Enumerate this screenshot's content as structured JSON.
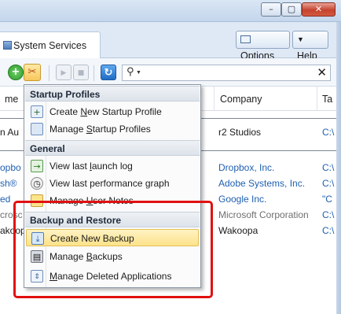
{
  "window": {
    "controls": {
      "minimize": "–",
      "maximize": "▢",
      "close": "✕"
    }
  },
  "tab": {
    "label": "System Services"
  },
  "header": {
    "options": {
      "pre": "",
      "accel": "O",
      "post": "ptions"
    },
    "help": {
      "pre": "",
      "accel": "H",
      "post": "elp"
    }
  },
  "toolbar": {
    "add": "+",
    "tools": "✂",
    "play": "▶",
    "stop": "■",
    "refresh": "↻",
    "search_icon": "⚲",
    "search_dropdown": "▼",
    "search_value": "",
    "clear": "✕"
  },
  "columns": {
    "name": "me",
    "company": "Company",
    "path": "Ta"
  },
  "rows": [
    {
      "name": "n Au",
      "company": "r2 Studios",
      "path": "C:\\",
      "style": "black"
    },
    {
      "name": "opbo",
      "company": "Dropbox, Inc.",
      "path": "C:\\",
      "style": "blue"
    },
    {
      "name": "sh®",
      "company": "Adobe Systems, Inc.",
      "path": "C:\\",
      "style": "blue"
    },
    {
      "name": "ed",
      "company": "Google Inc.",
      "path": "\"C",
      "style": "blue"
    },
    {
      "name": "crosc",
      "company": "Microsoft Corporation",
      "path": "C:\\",
      "style": "grey"
    },
    {
      "name": "akoop",
      "company": "Wakoopa",
      "path": "C:\\",
      "style": "black"
    }
  ],
  "menu": {
    "sections": [
      {
        "title": "Startup Profiles",
        "items": [
          {
            "pre": "Create ",
            "accel": "N",
            "post": "ew Startup Profile",
            "icon": "new-profile-icon"
          },
          {
            "pre": "Manage ",
            "accel": "S",
            "post": "tartup Profiles",
            "icon": "profiles-icon"
          }
        ]
      },
      {
        "title": "General",
        "items": [
          {
            "pre": "View last ",
            "accel": "l",
            "post": "aunch log",
            "icon": "log-icon"
          },
          {
            "pre": "View last performance graph",
            "accel": "",
            "post": "",
            "icon": "graph-icon"
          },
          {
            "pre": "Manage ",
            "accel": "U",
            "post": "ser Notes",
            "icon": "notes-icon"
          }
        ]
      },
      {
        "title": "Backup and Restore",
        "items": [
          {
            "pre": "Create New Backup",
            "accel": "",
            "post": "",
            "icon": "backup-icon",
            "highlighted": true
          },
          {
            "pre": "Manage ",
            "accel": "B",
            "post": "ackups",
            "icon": "backups-icon"
          },
          {
            "pre": "",
            "accel": "M",
            "post": "anage Deleted Applications",
            "icon": "deleted-apps-icon"
          }
        ]
      }
    ]
  },
  "colors": {
    "highlight_red": "#e11010",
    "link_blue": "#1f5fb0",
    "menu_highlight": "#fde28a"
  }
}
